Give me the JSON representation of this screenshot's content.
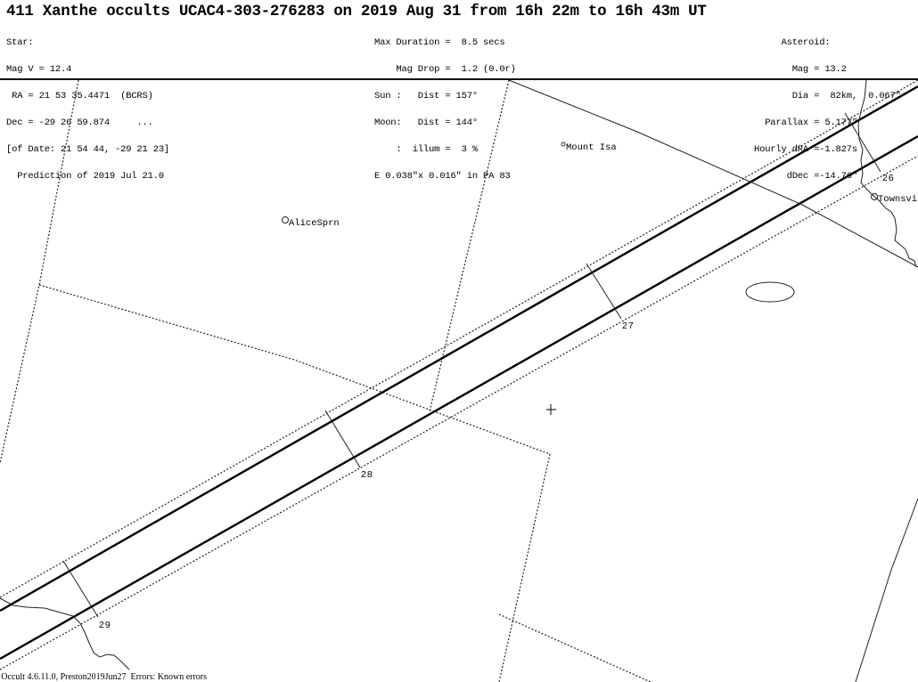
{
  "header": {
    "title": "411 Xanthe occults UCAC4-303-276283 on 2019 Aug 31 from 16h 22m to 16h 43m UT"
  },
  "star": {
    "lines": [
      "Star:",
      "Mag V = 12.4",
      " RA = 21 53 35.4471  (BCRS)",
      "Dec = -29 26 59.874     ...",
      "[of Date: 21 54 44, -29 21 23]",
      "  Prediction of 2019 Jul 21.0"
    ]
  },
  "event": {
    "lines": [
      "Max Duration =  8.5 secs",
      "    Mag Drop =  1.2 (0.0r)",
      "Sun :   Dist = 157°",
      "Moon:   Dist = 144°",
      "    :  illum =  3 %",
      "E 0.038\"x 0.016\" in PA 83"
    ]
  },
  "asteroid": {
    "lines": [
      "     Asteroid:",
      "       Mag = 13.2",
      "       Dia =  82km,  0.067\"",
      "  Parallax = 5.177\"",
      "Hourly dRA =-1.827s",
      "      dDec =-14.76\""
    ]
  },
  "map": {
    "cities": [
      {
        "name": "Mount Isa",
        "marker": "small-circle"
      },
      {
        "name": "AliceSprn",
        "marker": "circle"
      },
      {
        "name": "Townsvi",
        "marker": "circle"
      }
    ],
    "time_ticks": [
      "26",
      "27",
      "28",
      "29"
    ],
    "features": [
      "shadow-path-edges",
      "uncertainty-limits",
      "state-borders",
      "coastline",
      "road-line",
      "observer-ellipse",
      "center-crosshair"
    ]
  },
  "footer": {
    "text": "' Occult 4.6.11.0, Preston2019Jun27  Errors: Known errors"
  }
}
